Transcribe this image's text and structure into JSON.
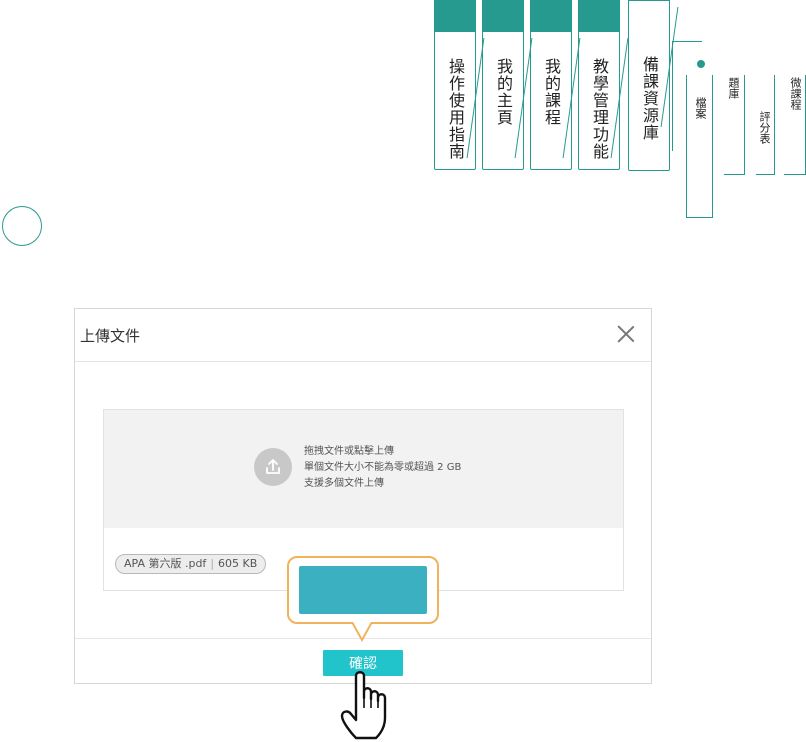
{
  "nav": {
    "tabs": [
      {
        "label": "操作使用指南"
      },
      {
        "label": "我的主頁"
      },
      {
        "label": "我的課程"
      },
      {
        "label": "教學管理功能"
      },
      {
        "label": "備課資源庫"
      }
    ],
    "sub_tabs": [
      {
        "label": "檔案"
      },
      {
        "label": "題庫"
      },
      {
        "label": "評分表"
      },
      {
        "label": "微課程"
      }
    ],
    "accent_color": "#269a8f"
  },
  "dialog": {
    "title": "上傳文件",
    "dropzone": {
      "line1": "拖拽文件或點擊上傳",
      "line2": "單個文件大小不能為零或超過 2 GB",
      "line3": "支援多個文件上傳"
    },
    "file": {
      "name": "APA 第六版 .pdf",
      "size": "605 KB"
    },
    "confirm_label": "確認",
    "confirm_color": "#21c4cb"
  },
  "callout": {
    "border_color": "#f0b25b",
    "fill_color": "#3ab0c1"
  },
  "icons": [
    "upload-icon",
    "close-icon",
    "pointer-hand-icon"
  ]
}
